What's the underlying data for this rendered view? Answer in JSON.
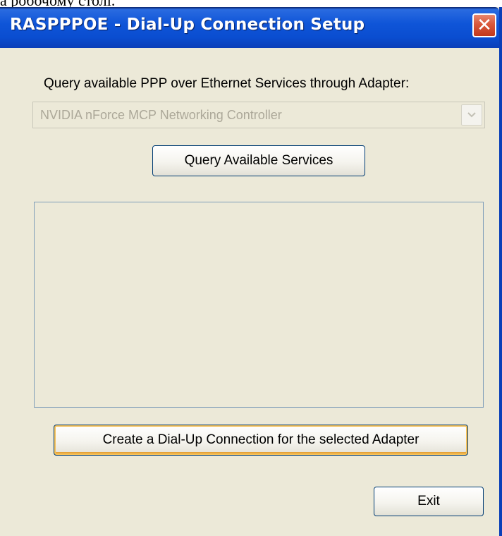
{
  "background_text": "а робочому столі.",
  "window": {
    "title": "RASPPPOE - Dial-Up Connection Setup",
    "close_glyph": "✕"
  },
  "adapter_label": "Query available PPP over Ethernet Services through Adapter:",
  "adapter_select": {
    "value": "NVIDIA nForce MCP Networking Controller",
    "disabled": true,
    "arrow_icon": "chevron-down-icon"
  },
  "buttons": {
    "query": "Query Available Services",
    "create": "Create a Dial-Up Connection for the selected Adapter",
    "exit": "Exit"
  },
  "services_list": {
    "items": []
  },
  "colors": {
    "titlebar": "#0a4dd0",
    "window_bg": "#ece9d8",
    "close_button": "#d9573a",
    "focus_ring": "#f6c25a"
  }
}
